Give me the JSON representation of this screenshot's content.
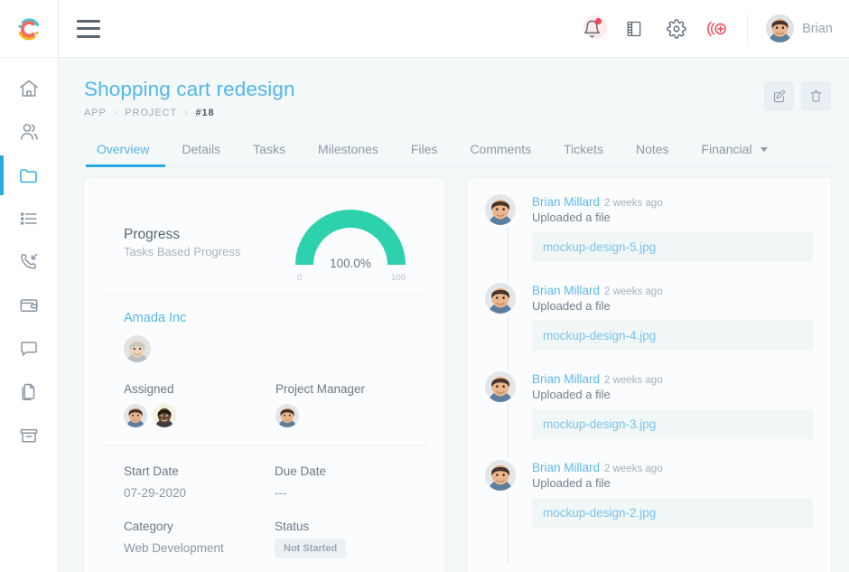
{
  "brand": {
    "logo_name": "circle-c-logo",
    "accent_blue": "#2aa8e0",
    "accent_teal": "#2ed1ad",
    "accent_red": "#f4455a"
  },
  "topbar": {
    "menu_label": "menu",
    "icons": [
      {
        "name": "notifications-bell-icon",
        "label": "Notifications",
        "has_badge": true
      },
      {
        "name": "notebook-icon",
        "label": "Notebook"
      },
      {
        "name": "settings-gear-icon",
        "label": "Settings"
      },
      {
        "name": "add-record-icon",
        "label": "Add"
      }
    ],
    "user": {
      "name": "Brian",
      "avatar_name": "user-avatar-brian"
    }
  },
  "sidebar": {
    "items": [
      {
        "icon": "home-icon",
        "label": "Home",
        "active": false
      },
      {
        "icon": "clients-icon",
        "label": "Clients",
        "active": false
      },
      {
        "icon": "projects-folder-icon",
        "label": "Projects",
        "active": true
      },
      {
        "icon": "tasks-list-icon",
        "label": "Tasks",
        "active": false
      },
      {
        "icon": "phone-callback-icon",
        "label": "Calls",
        "active": false
      },
      {
        "icon": "wallet-icon",
        "label": "Invoices",
        "active": false
      },
      {
        "icon": "chat-bubble-icon",
        "label": "Messages",
        "active": false
      },
      {
        "icon": "documents-icon",
        "label": "Documents",
        "active": false
      },
      {
        "icon": "archive-box-icon",
        "label": "Archive",
        "active": false
      }
    ]
  },
  "page": {
    "title": "Shopping cart redesign",
    "breadcrumb": {
      "first": "APP",
      "second": "PROJECT",
      "third": "#18",
      "separator": "›"
    },
    "actions": [
      {
        "name": "edit-project-button",
        "icon": "edit-pencil-icon",
        "label": "Edit"
      },
      {
        "name": "delete-project-button",
        "icon": "trash-icon",
        "label": "Delete"
      }
    ]
  },
  "tabs": [
    {
      "label": "Overview",
      "active": true,
      "dropdown": false
    },
    {
      "label": "Details",
      "active": false,
      "dropdown": false
    },
    {
      "label": "Tasks",
      "active": false,
      "dropdown": false
    },
    {
      "label": "Milestones",
      "active": false,
      "dropdown": false
    },
    {
      "label": "Files",
      "active": false,
      "dropdown": false
    },
    {
      "label": "Comments",
      "active": false,
      "dropdown": false
    },
    {
      "label": "Tickets",
      "active": false,
      "dropdown": false
    },
    {
      "label": "Notes",
      "active": false,
      "dropdown": false
    },
    {
      "label": "Financial",
      "active": false,
      "dropdown": true
    }
  ],
  "overview": {
    "progress": {
      "title": "Progress",
      "subtitle": "Tasks Based Progress",
      "value_label": "100.0%",
      "min_label": "0",
      "max_label": "100"
    },
    "client": {
      "name": "Amada Inc",
      "avatar_name": "client-avatar"
    },
    "assigned": {
      "label": "Assigned",
      "avatars": [
        "assigned-avatar-1",
        "assigned-avatar-2"
      ]
    },
    "project_manager": {
      "label": "Project Manager",
      "avatars": [
        "project-manager-avatar"
      ]
    },
    "fields": [
      [
        {
          "label": "Start Date",
          "value": "07-29-2020",
          "type": "text"
        },
        {
          "label": "Due Date",
          "value": "---",
          "type": "text"
        }
      ],
      [
        {
          "label": "Category",
          "value": "Web Development",
          "type": "text"
        },
        {
          "label": "Status",
          "value": "Not Started",
          "type": "badge"
        }
      ]
    ]
  },
  "chart_data": {
    "type": "gauge",
    "title": "Tasks Based Progress",
    "value": 100.0,
    "value_label": "100.0%",
    "min": 0,
    "max": 100,
    "min_label": "0",
    "max_label": "100",
    "color": "#2ed1ad",
    "track_color": "#fafcfd",
    "arc_degrees": 180
  },
  "activity": [
    {
      "user": "Brian Millard",
      "time": "2 weeks ago",
      "action": "Uploaded a file",
      "file": "mockup-design-5.jpg",
      "avatar_name": "activity-avatar"
    },
    {
      "user": "Brian Millard",
      "time": "2 weeks ago",
      "action": "Uploaded a file",
      "file": "mockup-design-4.jpg",
      "avatar_name": "activity-avatar"
    },
    {
      "user": "Brian Millard",
      "time": "2 weeks ago",
      "action": "Uploaded a file",
      "file": "mockup-design-3.jpg",
      "avatar_name": "activity-avatar"
    },
    {
      "user": "Brian Millard",
      "time": "2 weeks ago",
      "action": "Uploaded a file",
      "file": "mockup-design-2.jpg",
      "avatar_name": "activity-avatar"
    }
  ]
}
